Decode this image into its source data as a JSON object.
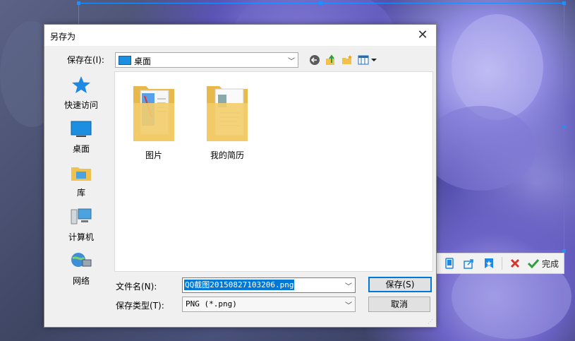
{
  "dialog": {
    "title": "另存为",
    "save_in_label": "保存在(I):",
    "location": "桌面",
    "file_name_label": "文件名(N):",
    "file_name_value": "QQ截图20150827103206.png",
    "file_type_label": "保存类型(T):",
    "file_type_value": "PNG (*.png)",
    "save_button": "保存(S)",
    "cancel_button": "取消"
  },
  "places": [
    {
      "label": "快速访问",
      "icon": "star-icon"
    },
    {
      "label": "桌面",
      "icon": "desktop-icon"
    },
    {
      "label": "库",
      "icon": "library-icon"
    },
    {
      "label": "计算机",
      "icon": "computer-icon"
    },
    {
      "label": "网络",
      "icon": "network-icon"
    }
  ],
  "folders": [
    {
      "label": "图片"
    },
    {
      "label": "我的简历"
    }
  ],
  "capture_toolbar": {
    "done_label": "完成"
  },
  "colors": {
    "accent": "#0078d7",
    "selection_border": "#1e90ff",
    "cancel_red": "#d9342b",
    "done_green": "#2e9e3e"
  }
}
